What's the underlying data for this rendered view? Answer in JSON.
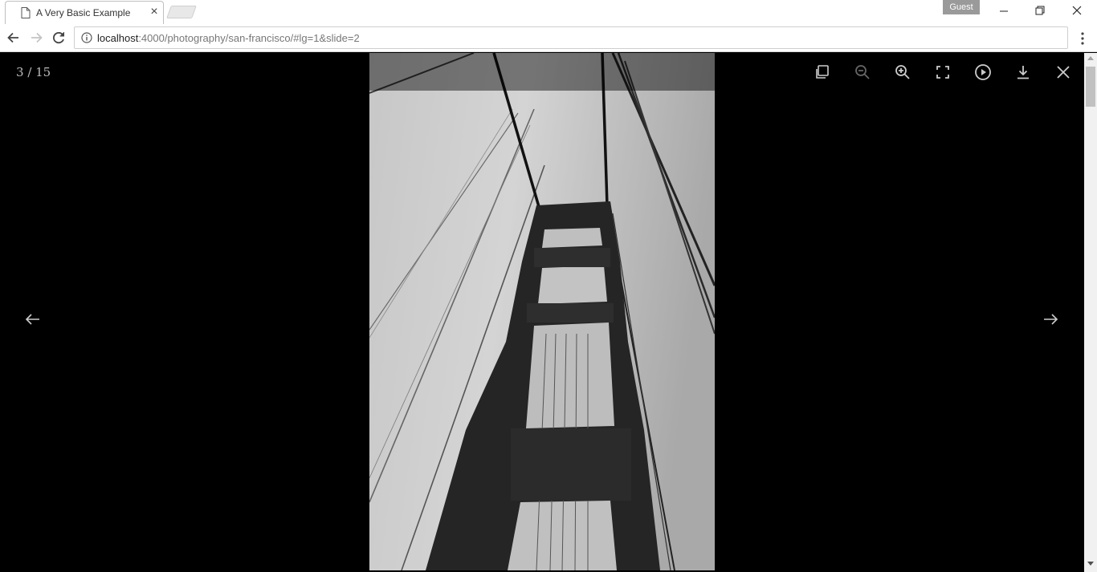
{
  "browser": {
    "tab_title": "A Very Basic Example",
    "close_tab_glyph": "×",
    "guest_label": "Guest",
    "url_host": "localhost",
    "url_rest": ":4000/photography/san-francisco/#lg=1&slide=2"
  },
  "gallery": {
    "counter_current": "3",
    "counter_separator": " / ",
    "counter_total": "15",
    "toolbar_icons": [
      "actual-size-icon",
      "zoom-out-icon",
      "zoom-in-icon",
      "fullscreen-icon",
      "autoplay-icon",
      "download-icon",
      "close-icon"
    ],
    "prev_icon": "arrow-left-icon",
    "next_icon": "arrow-right-icon",
    "zoom_out_disabled": true,
    "colors": {
      "background": "#000000",
      "icon": "#cccccc",
      "icon_disabled": "#666666"
    }
  }
}
